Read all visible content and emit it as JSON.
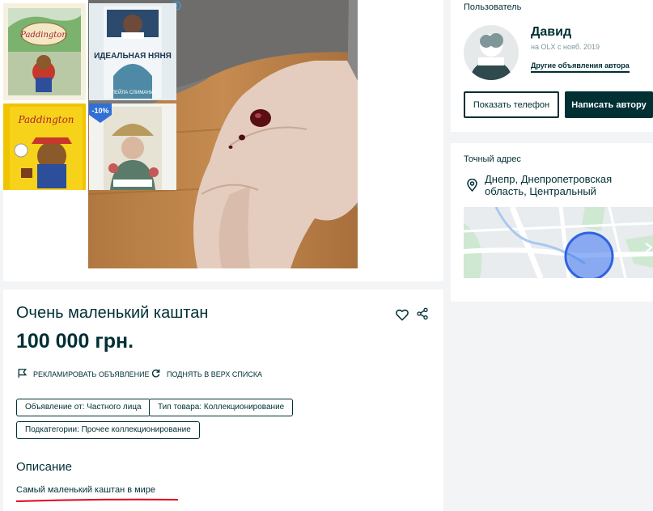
{
  "listing": {
    "title": "Очень маленький каштан",
    "price": "100 000 грн.",
    "promote_label": "Рекламировать объявление",
    "raise_label": "Поднять в верх списка",
    "tags": [
      "Объявление от: Частного лица",
      "Тип товара: Коллекционирование",
      "Подкатегории: Прочее коллекционирование"
    ],
    "description_title": "Описание",
    "description_text": "Самый маленький каштан в мире"
  },
  "user": {
    "section_label": "Пользователь",
    "name": "Давид",
    "since": "на OLX с нояб. 2019",
    "other_ads_link": "Другие объявления автора",
    "show_phone_button": "Показать телефон",
    "message_button": "Написать автору"
  },
  "address": {
    "section_label": "Точный адрес",
    "text": "Днепр, Днепропетровская область, Центральный"
  },
  "ads": {
    "books": [
      {
        "title": "Paddington",
        "cover_text": ""
      },
      {
        "title": "ИДЕАЛЬНАЯ НЯНЯ",
        "author": "ЛЕЙЛА СЛИМАНИ"
      },
      {
        "title": "Paddington",
        "cover_text": ""
      },
      {
        "title": "",
        "discount": "-10%"
      }
    ]
  },
  "colors": {
    "primary": "#002f34",
    "accent_underline": "#e3001b",
    "map_circle": "#3a74f0",
    "background": "#f2f4f5"
  }
}
